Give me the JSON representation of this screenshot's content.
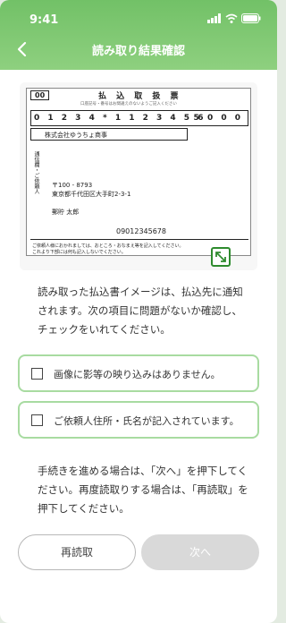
{
  "status_bar": {
    "time": "9:41"
  },
  "header": {
    "title": "読み取り結果確認"
  },
  "slip": {
    "code": "00",
    "title": "払 込 取 扱 票",
    "note": "口座記号・番号はお間違えのないようご記入ください",
    "account_digits": "0 1 2 3 4 * 1 1 2 3 4 5 6",
    "amount": "5 0 0 0",
    "kanyu_label": "加入者名",
    "kanyu_name": "株式会社ゆうちょ商事",
    "side_label": "通信欄・ご依頼人",
    "postcode_address_line1": "〒100 - 8793",
    "postcode_address_line2": "東京都千代田区大手町2-3-1",
    "requester_name": "郵貯 太郎",
    "phone": "09012345678",
    "footer_line1": "ご依頼人様におかれましては、おところ・おなまえ等を記入してください。",
    "footer_line2": "これより下部には何も記入しないでください。"
  },
  "description": "読み取った払込書イメージは、払込先に通知されます。次の項目に問題がないか確認し、チェックをいれてください。",
  "checks": [
    {
      "label": "画像に影等の映り込みはありません。"
    },
    {
      "label": "ご依頼人住所・氏名が記入されています。"
    }
  ],
  "guide": "手続きを進める場合は、「次へ」を押下してください。再度読取りする場合は、「再読取」を押下してください。",
  "buttons": {
    "reread": "再読取",
    "next": "次へ"
  },
  "colors": {
    "header_start": "#72c167",
    "header_end": "#8ed07f",
    "check_border": "#a8dba1",
    "disabled_button": "#d9d9d9",
    "accent": "#2e8b2e"
  }
}
